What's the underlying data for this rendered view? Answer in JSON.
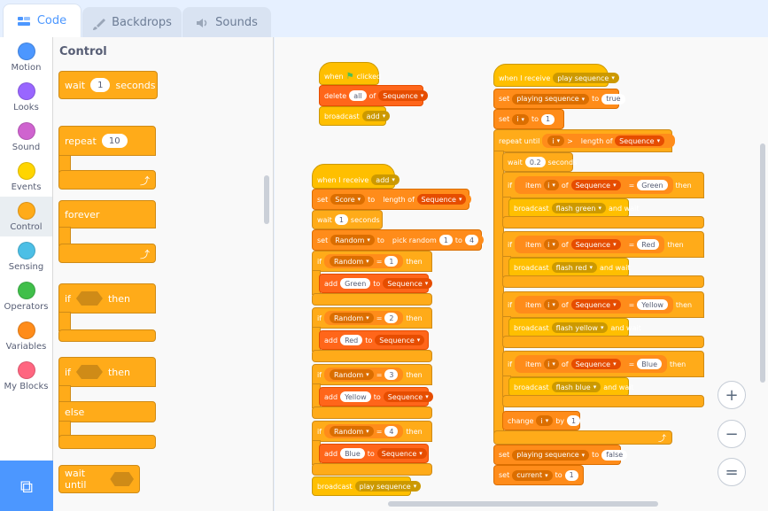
{
  "tabs": [
    {
      "label": "Code"
    },
    {
      "label": "Backdrops"
    },
    {
      "label": "Sounds"
    }
  ],
  "colors": {
    "accent": "#4c97ff",
    "control": "#ffab19",
    "events": "#ffbf00",
    "variables": "#ff8c1a",
    "lists": "#ff661a",
    "operators": "#59c059"
  },
  "categories": [
    {
      "label": "Motion",
      "color": "#4c97ff"
    },
    {
      "label": "Looks",
      "color": "#9966ff"
    },
    {
      "label": "Sound",
      "color": "#cf63cf"
    },
    {
      "label": "Events",
      "color": "#ffd500"
    },
    {
      "label": "Control",
      "color": "#ffab19"
    },
    {
      "label": "Sensing",
      "color": "#4cbfe6"
    },
    {
      "label": "Operators",
      "color": "#40bf4a"
    },
    {
      "label": "Variables",
      "color": "#ff8c1a"
    },
    {
      "label": "My Blocks",
      "color": "#ff6680"
    }
  ],
  "palette": {
    "title": "Control",
    "wait": {
      "label": "wait",
      "value": "1",
      "suffix": "seconds"
    },
    "repeat": {
      "label": "repeat",
      "value": "10"
    },
    "forever": {
      "label": "forever"
    },
    "if_then": {
      "label": "if",
      "then": "then"
    },
    "if_else": {
      "label": "if",
      "then": "then",
      "else": "else"
    },
    "wait_until": {
      "label": "wait until"
    }
  },
  "script1": {
    "hat": "when",
    "hat2": "clicked",
    "b1": {
      "a": "delete",
      "v": "all",
      "b": "of",
      "l": "Sequence"
    },
    "b2": {
      "a": "broadcast",
      "m": "add"
    }
  },
  "script2": {
    "hat": "when I receive",
    "msg": "add",
    "set_score": {
      "a": "set",
      "v": "Score",
      "b": "to",
      "c": "length of",
      "l": "Sequence"
    },
    "wait": {
      "a": "wait",
      "v": "1",
      "b": "seconds"
    },
    "set_random": {
      "a": "set",
      "v": "Random",
      "b": "to",
      "c": "pick random",
      "n1": "1",
      "d": "to",
      "n2": "4"
    },
    "ifs": [
      {
        "if": "if",
        "var": "Random",
        "eq": "=",
        "val": "1",
        "then": "then",
        "add": "add",
        "item": "Green",
        "to": "to",
        "list": "Sequence"
      },
      {
        "if": "if",
        "var": "Random",
        "eq": "=",
        "val": "2",
        "then": "then",
        "add": "add",
        "item": "Red",
        "to": "to",
        "list": "Sequence"
      },
      {
        "if": "if",
        "var": "Random",
        "eq": "=",
        "val": "3",
        "then": "then",
        "add": "add",
        "item": "Yellow",
        "to": "to",
        "list": "Sequence"
      },
      {
        "if": "if",
        "var": "Random",
        "eq": "=",
        "val": "4",
        "then": "then",
        "add": "add",
        "item": "Blue",
        "to": "to",
        "list": "Sequence"
      }
    ],
    "broadcast": {
      "a": "broadcast",
      "m": "play sequence"
    }
  },
  "script3": {
    "hat": "when I receive",
    "msg": "play sequence",
    "set1": {
      "a": "set",
      "v": "playing sequence",
      "b": "to",
      "val": "true"
    },
    "set2": {
      "a": "set",
      "v": "i",
      "b": "to",
      "val": "1"
    },
    "repeat_until": {
      "a": "repeat until",
      "v": "i",
      "gt": ">",
      "c": "length of",
      "l": "Sequence"
    },
    "wait": {
      "a": "wait",
      "v": "0.2",
      "b": "seconds"
    },
    "ifs": [
      {
        "if": "if",
        "item": "item",
        "i": "i",
        "of": "of",
        "l": "Sequence",
        "eq": "=",
        "color": "Green",
        "then": "then",
        "b": "broadcast",
        "m": "flash green",
        "w": "and wait"
      },
      {
        "if": "if",
        "item": "item",
        "i": "i",
        "of": "of",
        "l": "Sequence",
        "eq": "=",
        "color": "Red",
        "then": "then",
        "b": "broadcast",
        "m": "flash red",
        "w": "and wait"
      },
      {
        "if": "if",
        "item": "item",
        "i": "i",
        "of": "of",
        "l": "Sequence",
        "eq": "=",
        "color": "Yellow",
        "then": "then",
        "b": "broadcast",
        "m": "flash yellow",
        "w": "and wait"
      },
      {
        "if": "if",
        "item": "item",
        "i": "i",
        "of": "of",
        "l": "Sequence",
        "eq": "=",
        "color": "Blue",
        "then": "then",
        "b": "broadcast",
        "m": "flash blue",
        "w": "and wait"
      }
    ],
    "change": {
      "a": "change",
      "v": "i",
      "b": "by",
      "val": "1"
    },
    "set3": {
      "a": "set",
      "v": "playing sequence",
      "b": "to",
      "val": "false"
    },
    "set4": {
      "a": "set",
      "v": "current",
      "b": "to",
      "val": "1"
    }
  },
  "zoom": {
    "in": "+",
    "out": "−",
    "reset": "="
  }
}
